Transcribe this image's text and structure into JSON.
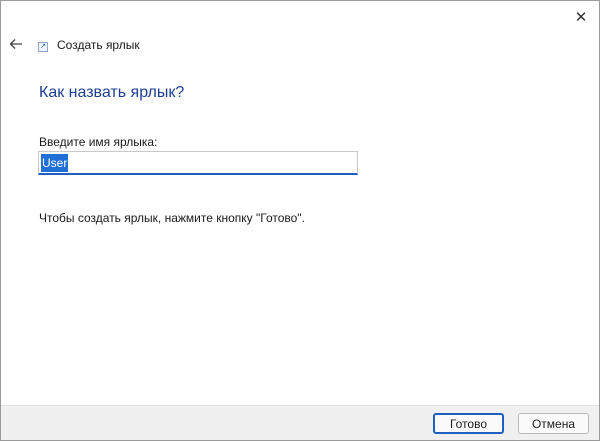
{
  "window": {
    "title": "Создать ярлык",
    "close_glyph": "✕",
    "back_glyph": "←"
  },
  "main": {
    "heading": "Как назвать ярлык?",
    "field_label": "Введите имя ярлыка:",
    "name_value": "User",
    "hint": "Чтобы создать ярлык, нажмите кнопку \"Готово\"."
  },
  "footer": {
    "ok_label": "Готово",
    "cancel_label": "Отмена"
  },
  "colors": {
    "accent": "#1f5fbf",
    "heading": "#1b3f93",
    "selection": "#1f6fd6"
  },
  "icons": [
    "close-icon",
    "back-arrow-icon",
    "shortcut-icon"
  ]
}
